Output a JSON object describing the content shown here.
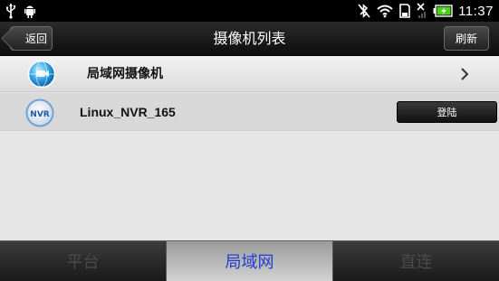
{
  "status_bar": {
    "left_icons": [
      "usb-icon",
      "android-debug-icon"
    ],
    "right_icons": [
      "bluetooth-off-icon",
      "wifi-icon",
      "sd-card-icon",
      "no-signal-icon",
      "battery-icon"
    ],
    "time": "11:37"
  },
  "header": {
    "back_label": "返回",
    "title": "摄像机列表",
    "refresh_label": "刷新"
  },
  "list": {
    "rows": [
      {
        "label": "局域网摄像机",
        "icon": "globe-camera-icon",
        "action_icon": "chevron-right-icon"
      },
      {
        "label": "Linux_NVR_165",
        "icon": "nvr-icon",
        "icon_text": "NVR",
        "action_label": "登陆"
      }
    ]
  },
  "tabs": [
    {
      "label": "平台",
      "active": false
    },
    {
      "label": "局域网",
      "active": true
    },
    {
      "label": "直连",
      "active": false
    }
  ],
  "colors": {
    "active_tab_text": "#1f3fd0",
    "inactive_tab_text": "#4a4a4a",
    "battery": "#4bd018"
  }
}
